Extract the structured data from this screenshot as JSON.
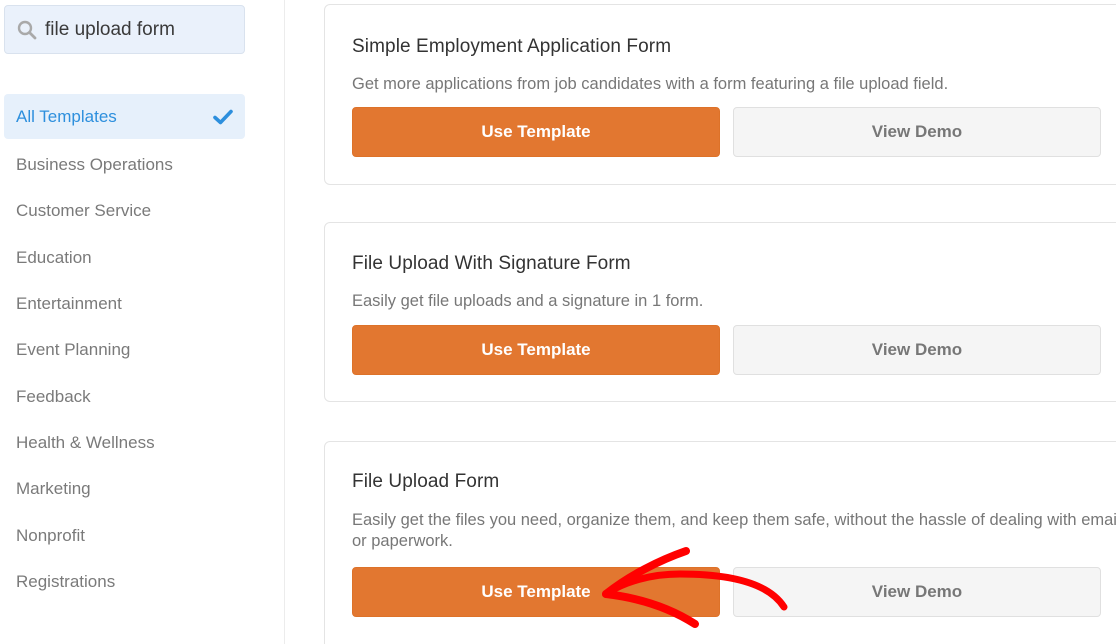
{
  "search": {
    "value": "file upload form",
    "icon": "search-icon"
  },
  "sidebar": {
    "active_category": {
      "label": "All Templates",
      "icon": "check-icon"
    },
    "categories": [
      {
        "label": "Business Operations"
      },
      {
        "label": "Customer Service"
      },
      {
        "label": "Education"
      },
      {
        "label": "Entertainment"
      },
      {
        "label": "Event Planning"
      },
      {
        "label": "Feedback"
      },
      {
        "label": "Health & Wellness"
      },
      {
        "label": "Marketing"
      },
      {
        "label": "Nonprofit"
      },
      {
        "label": "Registrations"
      }
    ]
  },
  "templates": [
    {
      "title": "Simple Employment Application Form",
      "description": "Get more applications from job candidates with a form featuring a file upload field.",
      "use_label": "Use Template",
      "demo_label": "View Demo"
    },
    {
      "title": "File Upload With Signature Form",
      "description": "Easily get file uploads and a signature in 1 form.",
      "use_label": "Use Template",
      "demo_label": "View Demo"
    },
    {
      "title": "File Upload Form",
      "description": "Easily get the files you need, organize them, and keep them safe, without the hassle of dealing with email or paperwork.",
      "use_label": "Use Template",
      "demo_label": "View Demo"
    }
  ],
  "annotation": {
    "type": "red-arrow",
    "points_to": "File Upload Form - Use Template",
    "color": "#ff0000"
  },
  "colors": {
    "accent_blue": "#2d8fdd",
    "button_orange": "#e27730",
    "annotation_red": "#ff0000"
  }
}
